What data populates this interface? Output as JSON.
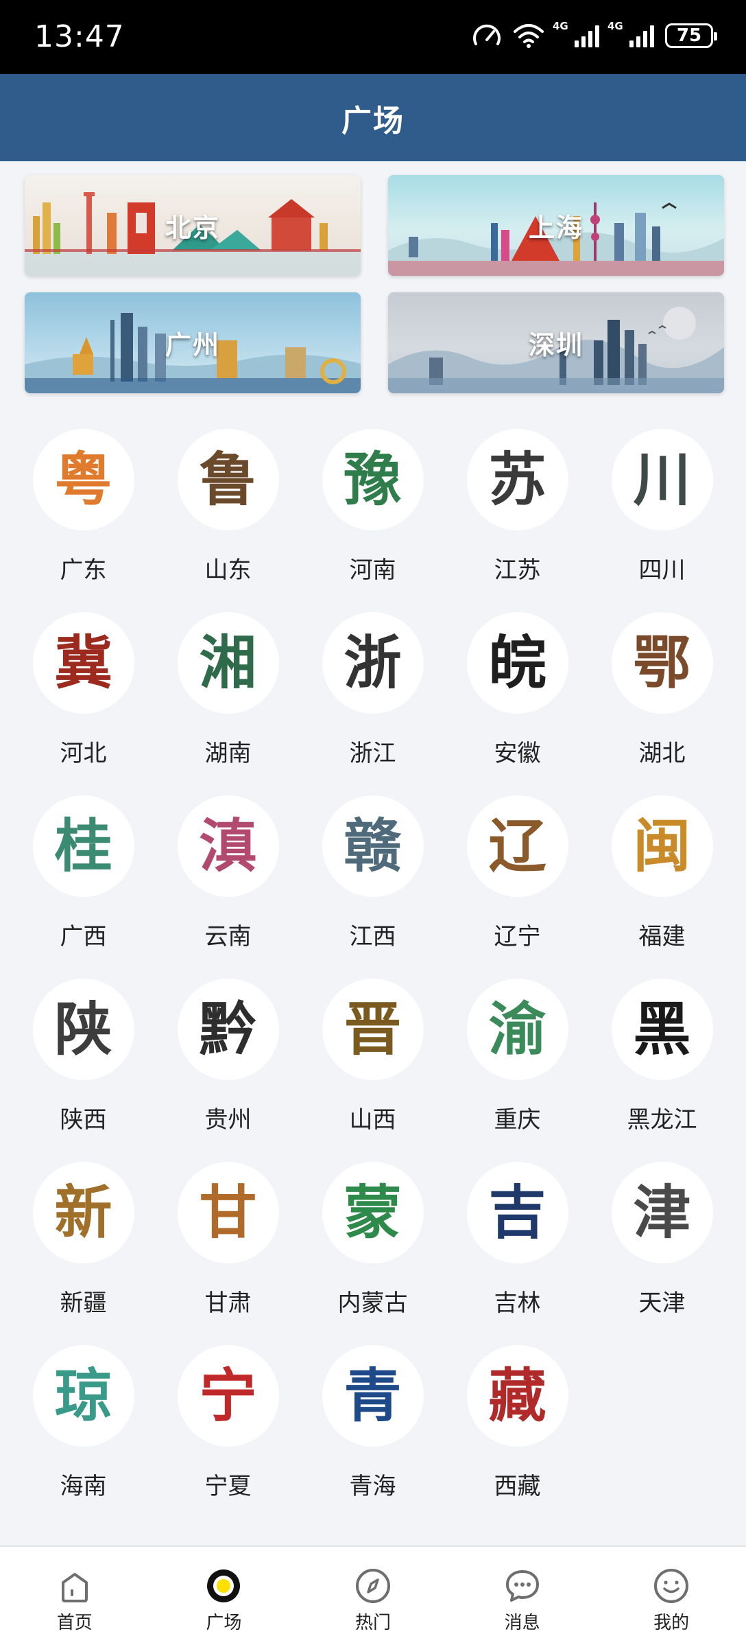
{
  "status_bar": {
    "time": "13:47",
    "net1": "4G",
    "net2": "4G",
    "battery": "75"
  },
  "header": {
    "title": "广场"
  },
  "cities": [
    {
      "label": "北京"
    },
    {
      "label": "上海"
    },
    {
      "label": "广州"
    },
    {
      "label": "深圳"
    }
  ],
  "provinces": [
    {
      "name": "广东",
      "glyph": "粤",
      "color": "#e07b2e"
    },
    {
      "name": "山东",
      "glyph": "鲁",
      "color": "#6b4a2b"
    },
    {
      "name": "河南",
      "glyph": "豫",
      "color": "#2e7d4a"
    },
    {
      "name": "江苏",
      "glyph": "苏",
      "color": "#3a3a3a"
    },
    {
      "name": "四川",
      "glyph": "川",
      "color": "#3f4a48"
    },
    {
      "name": "河北",
      "glyph": "冀",
      "color": "#9c2a1e"
    },
    {
      "name": "湖南",
      "glyph": "湘",
      "color": "#2f6b4a"
    },
    {
      "name": "浙江",
      "glyph": "浙",
      "color": "#333333"
    },
    {
      "name": "安徽",
      "glyph": "皖",
      "color": "#1f1f1f"
    },
    {
      "name": "湖北",
      "glyph": "鄂",
      "color": "#7a4a2a"
    },
    {
      "name": "广西",
      "glyph": "桂",
      "color": "#3b8a72"
    },
    {
      "name": "云南",
      "glyph": "滇",
      "color": "#b2496e"
    },
    {
      "name": "江西",
      "glyph": "赣",
      "color": "#4f6a7a"
    },
    {
      "name": "辽宁",
      "glyph": "辽",
      "color": "#8a5a2a"
    },
    {
      "name": "福建",
      "glyph": "闽",
      "color": "#c98a2a"
    },
    {
      "name": "陕西",
      "glyph": "陕",
      "color": "#3d3d3d"
    },
    {
      "name": "贵州",
      "glyph": "黔",
      "color": "#2e2e2e"
    },
    {
      "name": "山西",
      "glyph": "晋",
      "color": "#7a5a1e"
    },
    {
      "name": "重庆",
      "glyph": "渝",
      "color": "#3b8a5a"
    },
    {
      "name": "黑龙江",
      "glyph": "黑",
      "color": "#1a1a1a"
    },
    {
      "name": "新疆",
      "glyph": "新",
      "color": "#a0702a"
    },
    {
      "name": "甘肃",
      "glyph": "甘",
      "color": "#b06a2a"
    },
    {
      "name": "内蒙古",
      "glyph": "蒙",
      "color": "#2e8a4a"
    },
    {
      "name": "吉林",
      "glyph": "吉",
      "color": "#1f3a6a"
    },
    {
      "name": "天津",
      "glyph": "津",
      "color": "#4a4a4a"
    },
    {
      "name": "海南",
      "glyph": "琼",
      "color": "#3a9a8a"
    },
    {
      "name": "宁夏",
      "glyph": "宁",
      "color": "#c0282a"
    },
    {
      "name": "青海",
      "glyph": "青",
      "color": "#1f4a8a"
    },
    {
      "name": "西藏",
      "glyph": "藏",
      "color": "#b02a2a"
    }
  ],
  "tabs": [
    {
      "label": "首页",
      "icon": "home-icon",
      "active": false
    },
    {
      "label": "广场",
      "icon": "square-icon",
      "active": true
    },
    {
      "label": "热门",
      "icon": "compass-icon",
      "active": false
    },
    {
      "label": "消息",
      "icon": "message-icon",
      "active": false
    },
    {
      "label": "我的",
      "icon": "smile-icon",
      "active": false
    }
  ],
  "colors": {
    "header": "#305c8c",
    "active_tab": "#ffe000",
    "background": "#f2f4f8"
  }
}
